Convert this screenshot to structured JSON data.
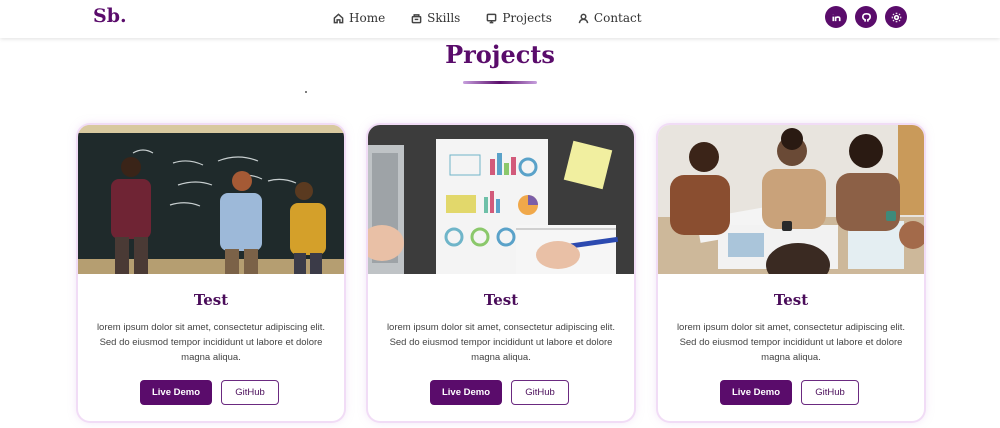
{
  "brand": {
    "logo": "Sb.",
    "accent": "#5a0c6b"
  },
  "nav": {
    "links": [
      {
        "label": "Home",
        "icon": "home-icon"
      },
      {
        "label": "Skills",
        "icon": "skills-icon"
      },
      {
        "label": "Projects",
        "icon": "projects-icon"
      },
      {
        "label": "Contact",
        "icon": "contact-icon"
      }
    ],
    "icons": [
      "linkedin-icon",
      "github-icon",
      "theme-toggle-icon"
    ]
  },
  "section": {
    "title": "Projects"
  },
  "projects": [
    {
      "title": "Test",
      "description": "lorem ipsum dolor sit amet, consectetur adipiscing elit. Sed do eiusmod tempor incididunt ut labore et dolore magna aliqua.",
      "demo_label": "Live Demo",
      "github_label": "GitHub"
    },
    {
      "title": "Test",
      "description": "lorem ipsum dolor sit amet, consectetur adipiscing elit. Sed do eiusmod tempor incididunt ut labore et dolore magna aliqua.",
      "demo_label": "Live Demo",
      "github_label": "GitHub"
    },
    {
      "title": "Test",
      "description": "lorem ipsum dolor sit amet, consectetur adipiscing elit. Sed do eiusmod tempor incididunt ut labore et dolore magna aliqua.",
      "demo_label": "Live Demo",
      "github_label": "GitHub"
    }
  ]
}
